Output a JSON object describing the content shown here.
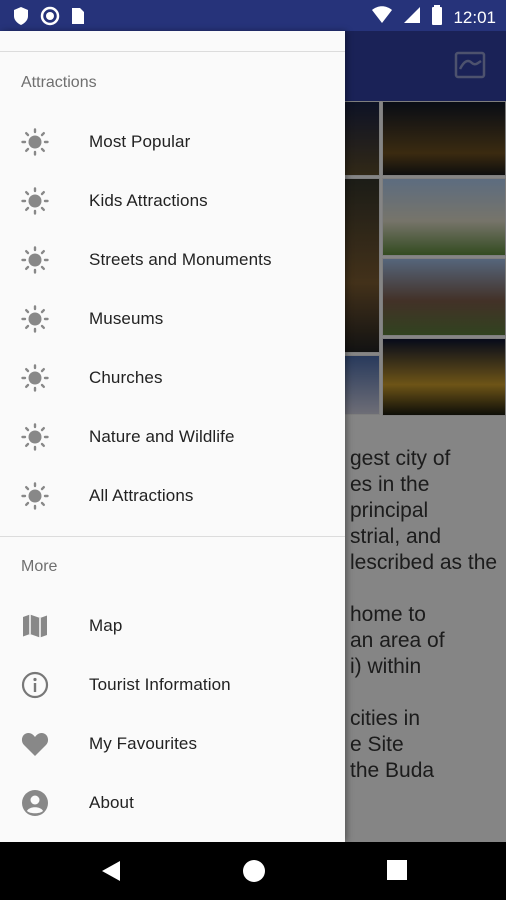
{
  "status_bar": {
    "time": "12:01",
    "left_icons": [
      "shield-icon",
      "circle-icon",
      "sim-card-icon"
    ],
    "right_icons": [
      "wifi-icon",
      "signal-icon",
      "battery-icon"
    ],
    "color": "#26337a"
  },
  "drawer": {
    "sections": [
      {
        "header": "Attractions",
        "items": [
          {
            "label": "Most Popular",
            "icon": "sun-icon"
          },
          {
            "label": "Kids Attractions",
            "icon": "sun-icon"
          },
          {
            "label": "Streets and Monuments",
            "icon": "sun-icon"
          },
          {
            "label": "Museums",
            "icon": "sun-icon"
          },
          {
            "label": "Churches",
            "icon": "sun-icon"
          },
          {
            "label": "Nature and Wildlife",
            "icon": "sun-icon"
          },
          {
            "label": "All Attractions",
            "icon": "sun-icon"
          }
        ]
      },
      {
        "header": "More",
        "items": [
          {
            "label": "Map",
            "icon": "map-icon"
          },
          {
            "label": "Tourist Information",
            "icon": "info-icon"
          },
          {
            "label": "My Favourites",
            "icon": "heart-icon"
          },
          {
            "label": "About",
            "icon": "account-icon"
          }
        ]
      }
    ]
  },
  "background": {
    "toolbar_color": "#303f9f",
    "text_lines": [
      "gest city of",
      "es in the",
      "principal",
      "strial, and",
      "lescribed as the",
      "home to",
      "an area of",
      "i) within",
      "cities in",
      "e Site",
      "the Buda"
    ]
  },
  "nav_bar": {
    "buttons": [
      "back-icon",
      "home-icon",
      "recents-icon"
    ]
  }
}
